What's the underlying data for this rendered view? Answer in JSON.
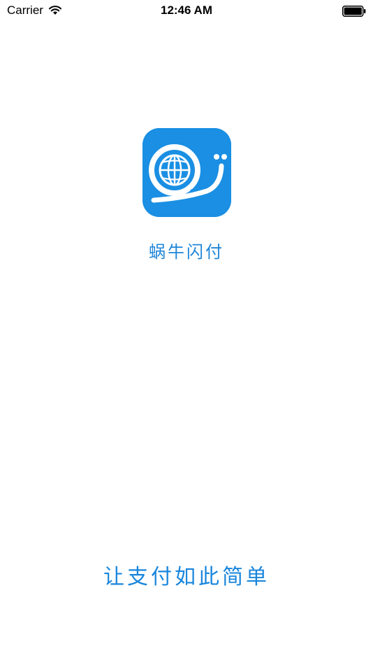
{
  "status_bar": {
    "carrier": "Carrier",
    "time": "12:46 AM",
    "wifi_icon": "wifi-icon",
    "battery_icon": "battery-icon"
  },
  "app": {
    "icon": "snail-globe-logo-icon",
    "name": "蜗牛闪付",
    "slogan": "让支付如此简单"
  },
  "colors": {
    "brand_blue": "#1a8fe3",
    "text_blue": "#1f86d8",
    "background": "#ffffff"
  }
}
